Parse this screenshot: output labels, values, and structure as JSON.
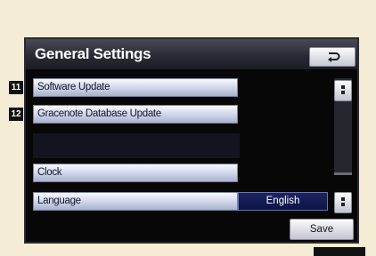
{
  "screen": {
    "title": "General Settings",
    "back_icon": "return-arrow-icon"
  },
  "menu": {
    "items": [
      {
        "label": "Software Update",
        "callout": "11"
      },
      {
        "label": "Gracenote Database Update",
        "callout": "12"
      },
      {
        "label": "Clock"
      },
      {
        "label": "Language",
        "value": "English"
      }
    ]
  },
  "scroll": {
    "up_icon": "scroll-dots-icon",
    "down_icon": "scroll-dots-icon"
  },
  "actions": {
    "save_label": "Save"
  }
}
